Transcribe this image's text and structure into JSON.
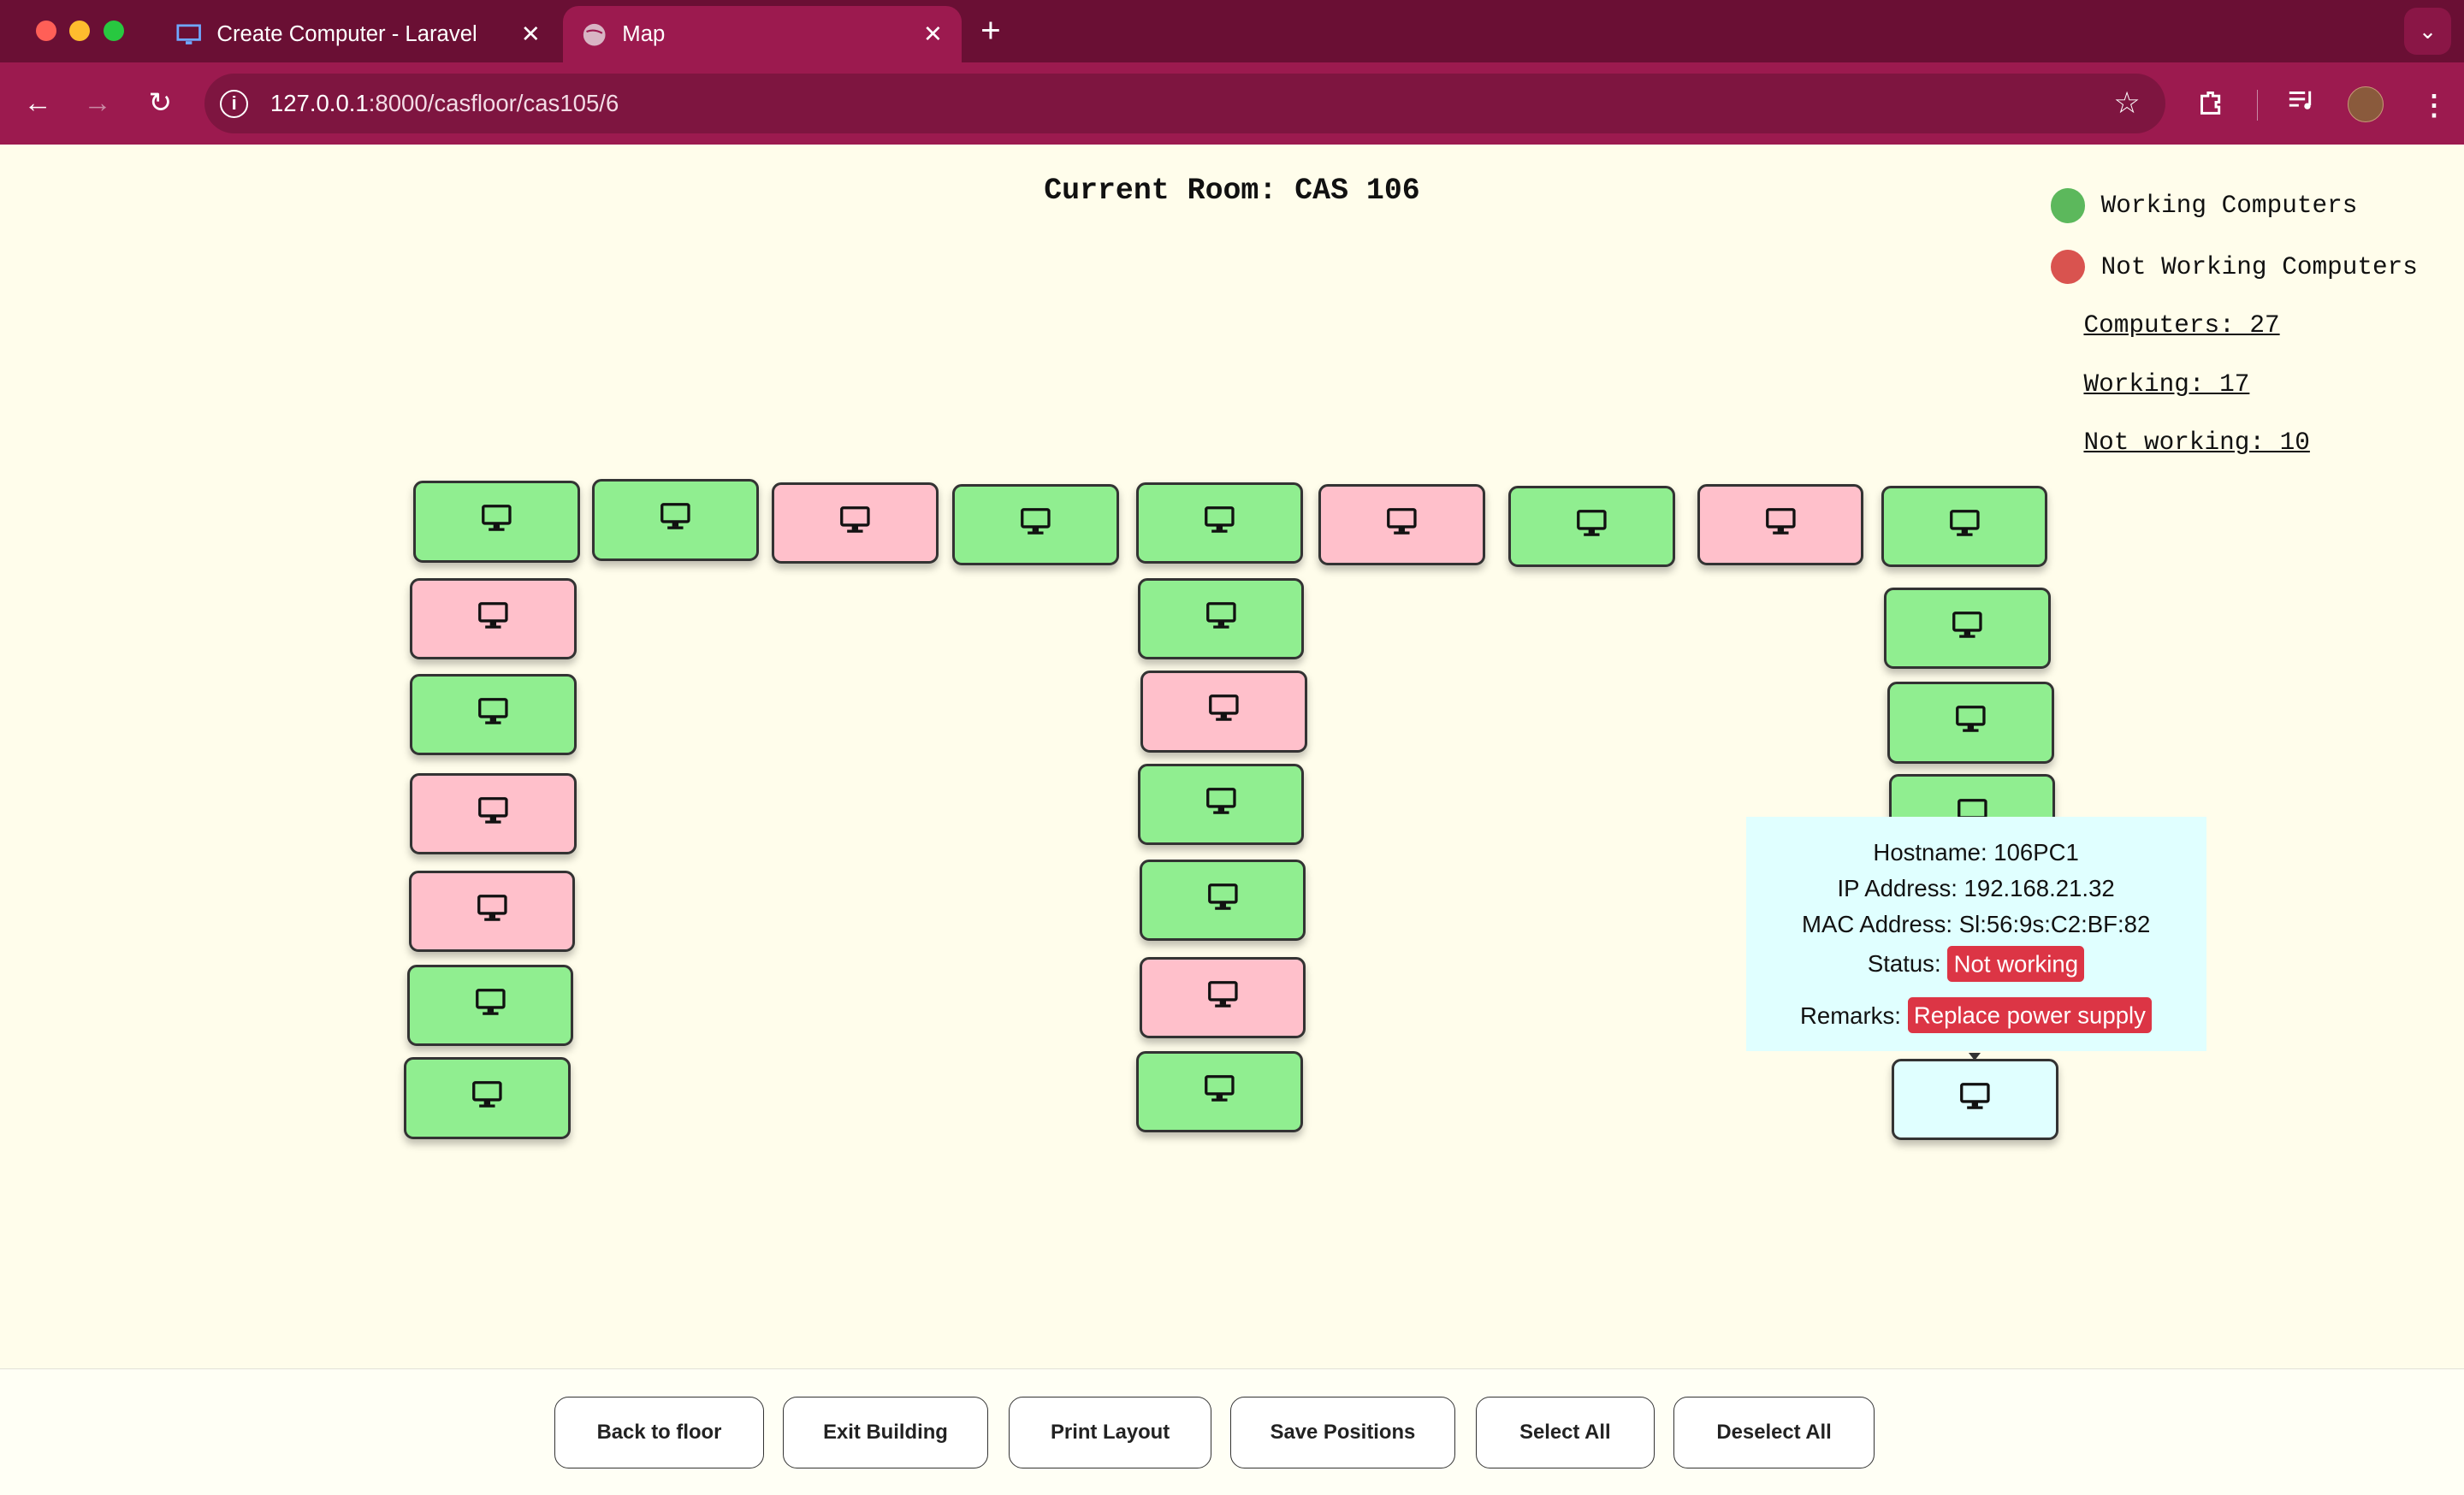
{
  "browser": {
    "tabs": [
      {
        "title": "Create Computer - Laravel",
        "icon": "monitor-icon"
      },
      {
        "title": "Map",
        "icon": "globe-icon"
      }
    ],
    "url_host": "127.0.0.1",
    "url_path": ":8000/casfloor/cas105/6"
  },
  "page": {
    "title": "Current Room: CAS 106"
  },
  "legend": {
    "working_label": "Working Computers",
    "working_color": "#5cb85c",
    "not_working_label": "Not Working Computers",
    "not_working_color": "#d9534f"
  },
  "stats": {
    "computers": "Computers: 27",
    "working": "Working: 17",
    "not_working": "Not working: 10"
  },
  "computers": [
    {
      "status": "working"
    },
    {
      "status": "working"
    },
    {
      "status": "not working"
    },
    {
      "status": "working"
    },
    {
      "status": "working"
    },
    {
      "status": "not working"
    },
    {
      "status": "working"
    },
    {
      "status": "not working"
    },
    {
      "status": "working"
    },
    {
      "status": "not working"
    },
    {
      "status": "working"
    },
    {
      "status": "not working"
    },
    {
      "status": "not working"
    },
    {
      "status": "working"
    },
    {
      "status": "working"
    },
    {
      "status": "working"
    },
    {
      "status": "not working"
    },
    {
      "status": "working"
    },
    {
      "status": "working"
    },
    {
      "status": "not working"
    },
    {
      "status": "working"
    },
    {
      "status": "working"
    },
    {
      "status": "working"
    },
    {
      "status": "working"
    },
    {
      "status": "selected"
    }
  ],
  "tooltip": {
    "hostname": "Hostname: 106PC1",
    "ip": "IP Address: 192.168.21.32",
    "mac": "MAC Address: Sl:56:9s:C2:BF:82",
    "status_label": "Status:",
    "status_value": "Not working",
    "remarks_label": "Remarks:",
    "remarks_value": "Replace power supply"
  },
  "footer": {
    "back": "Back to floor",
    "exit": "Exit Building",
    "print": "Print Layout",
    "save": "Save Positions",
    "select_all": "Select All",
    "deselect_all": "Deselect All"
  }
}
